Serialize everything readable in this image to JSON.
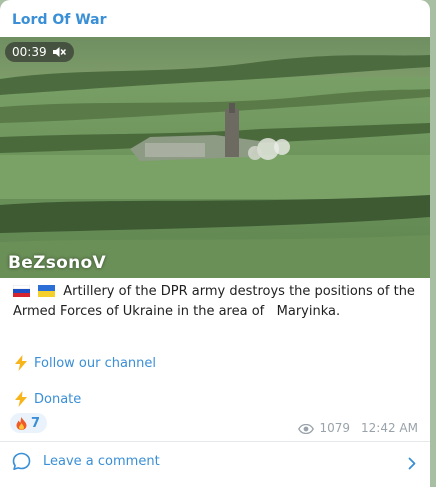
{
  "channel": {
    "name": "Lord Of War"
  },
  "video": {
    "duration": "00:39",
    "muted": true,
    "watermark": "BeZsonoV",
    "mute_icon": "speaker-muted-icon"
  },
  "post": {
    "flags": [
      "russia-flag-icon",
      "ukraine-flag-icon"
    ],
    "caption": "Artillery of the DPR army destroys the positions of the Armed Forces of Ukraine in the area of   Maryinka.",
    "links": [
      {
        "icon": "lightning-icon",
        "label": "Follow our channel"
      },
      {
        "icon": "lightning-icon",
        "label": "Donate"
      }
    ]
  },
  "reactions": [
    {
      "icon": "fire-icon",
      "count": "7"
    }
  ],
  "meta": {
    "views": "1079",
    "time": "12:42 AM"
  },
  "comments": {
    "label": "Leave a comment"
  },
  "colors": {
    "accent": "#3a8fd6",
    "page_bg": "#a9bfa3",
    "meta_gray": "#9aa3ab"
  }
}
